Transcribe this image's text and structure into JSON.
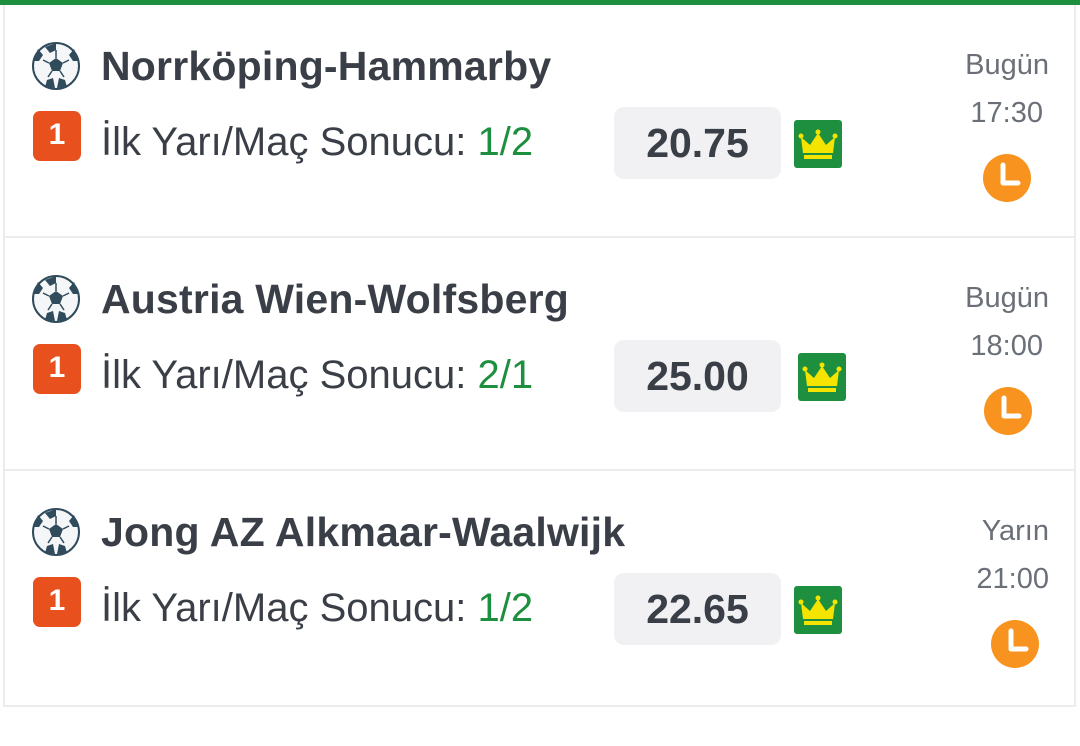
{
  "accent_color": "#1e8f3e",
  "badge_color": "#e8501e",
  "clock_color": "#f7931e",
  "matches": [
    {
      "title": "Norrköping-Hammarby",
      "badge": "1",
      "bet_label": "İlk Yarı/Maç Sonucu: ",
      "bet_value": "1/2",
      "odds": "20.75",
      "day": "Bugün",
      "time": "17:30",
      "icons": [
        "soccer-ball-icon",
        "crown-icon",
        "clock-icon"
      ]
    },
    {
      "title": "Austria Wien-Wolfsberg",
      "badge": "1",
      "bet_label": "İlk Yarı/Maç Sonucu: ",
      "bet_value": "2/1",
      "odds": "25.00",
      "day": "Bugün",
      "time": "18:00",
      "icons": [
        "soccer-ball-icon",
        "crown-icon",
        "clock-icon"
      ]
    },
    {
      "title": "Jong AZ Alkmaar-Waalwijk",
      "badge": "1",
      "bet_label": "İlk Yarı/Maç Sonucu: ",
      "bet_value": "1/2",
      "odds": "22.65",
      "day": "Yarın",
      "time": "21:00",
      "icons": [
        "soccer-ball-icon",
        "crown-icon",
        "clock-icon"
      ]
    }
  ]
}
